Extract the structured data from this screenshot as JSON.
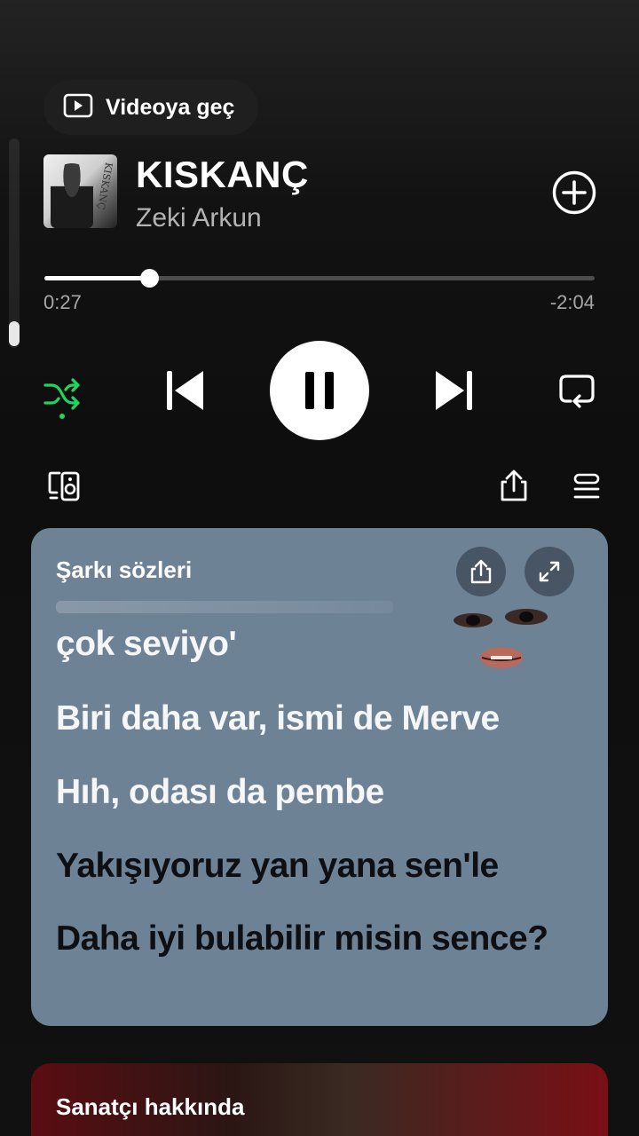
{
  "player": {
    "video_button_label": "Videoya geç",
    "track": {
      "title": "KISKANÇ",
      "artist": "Zeki Arkun",
      "cover_signature": "KISKANÇ"
    },
    "progress": {
      "elapsed": "0:27",
      "remaining": "-2:04",
      "fraction": 0.19
    },
    "controls": {
      "shuffle_active": true,
      "state": "playing"
    },
    "icons": {
      "video": "video-icon",
      "add": "add-circle-icon",
      "shuffle": "shuffle-icon",
      "previous": "skip-previous-icon",
      "pause": "pause-icon",
      "next": "skip-next-icon",
      "repeat": "repeat-icon",
      "devices": "connect-devices-icon",
      "share": "share-icon",
      "queue": "queue-icon"
    },
    "colors": {
      "accent": "#1ed760",
      "lyrics_card": "#6e8296"
    }
  },
  "lyrics": {
    "header": "Şarkı sözleri",
    "lines": [
      {
        "text": "çok seviyo'",
        "state": "past"
      },
      {
        "text": "Biri daha var, ismi de Merve",
        "state": "past"
      },
      {
        "text": "Hıh, odası da pembe",
        "state": "past"
      },
      {
        "text": "Yakışıyoruz yan yana sen'le",
        "state": "future"
      },
      {
        "text": "Daha iyi bulabilir misin sence?",
        "state": "future"
      }
    ]
  },
  "about": {
    "title": "Sanatçı hakkında"
  }
}
